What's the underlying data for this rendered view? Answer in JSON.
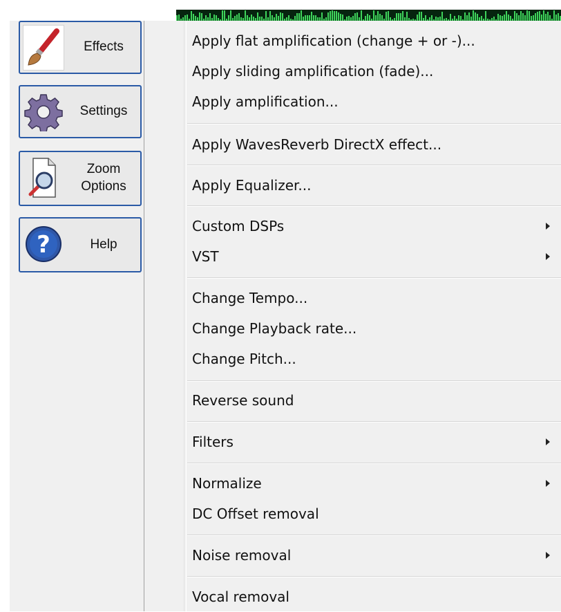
{
  "toolbar": {
    "buttons": [
      {
        "id": "effects",
        "label": "Effects",
        "icon": "paintbrush-icon",
        "active": true
      },
      {
        "id": "settings",
        "label": "Settings",
        "icon": "gear-icon",
        "active": false
      },
      {
        "id": "zoom",
        "label": "Zoom\nOptions",
        "icon": "magnifier-icon",
        "active": false
      },
      {
        "id": "help",
        "label": "Help",
        "icon": "help-icon",
        "active": false
      }
    ]
  },
  "menu": {
    "items": [
      {
        "label": "Apply flat amplification (change + or -)..."
      },
      {
        "label": "Apply sliding  amplification (fade)..."
      },
      {
        "label": "Apply amplification..."
      },
      {
        "label": "Apply WavesReverb DirectX effect..."
      },
      {
        "label": "Apply Equalizer..."
      },
      {
        "label": "Custom DSPs",
        "submenu": true
      },
      {
        "label": "VST",
        "submenu": true
      },
      {
        "label": "Change Tempo..."
      },
      {
        "label": "Change Playback rate..."
      },
      {
        "label": "Change Pitch..."
      },
      {
        "label": "Reverse sound"
      },
      {
        "label": "Filters",
        "submenu": true
      },
      {
        "label": "Normalize",
        "submenu": true
      },
      {
        "label": "DC Offset removal"
      },
      {
        "label": "Noise removal",
        "submenu": true
      },
      {
        "label": "Vocal removal"
      }
    ]
  },
  "colors": {
    "menu_bg": "#f0f0f0",
    "button_border": "#2a5aa6",
    "waveform_bg": "#06240f",
    "waveform_fg": "#3fd35b"
  }
}
